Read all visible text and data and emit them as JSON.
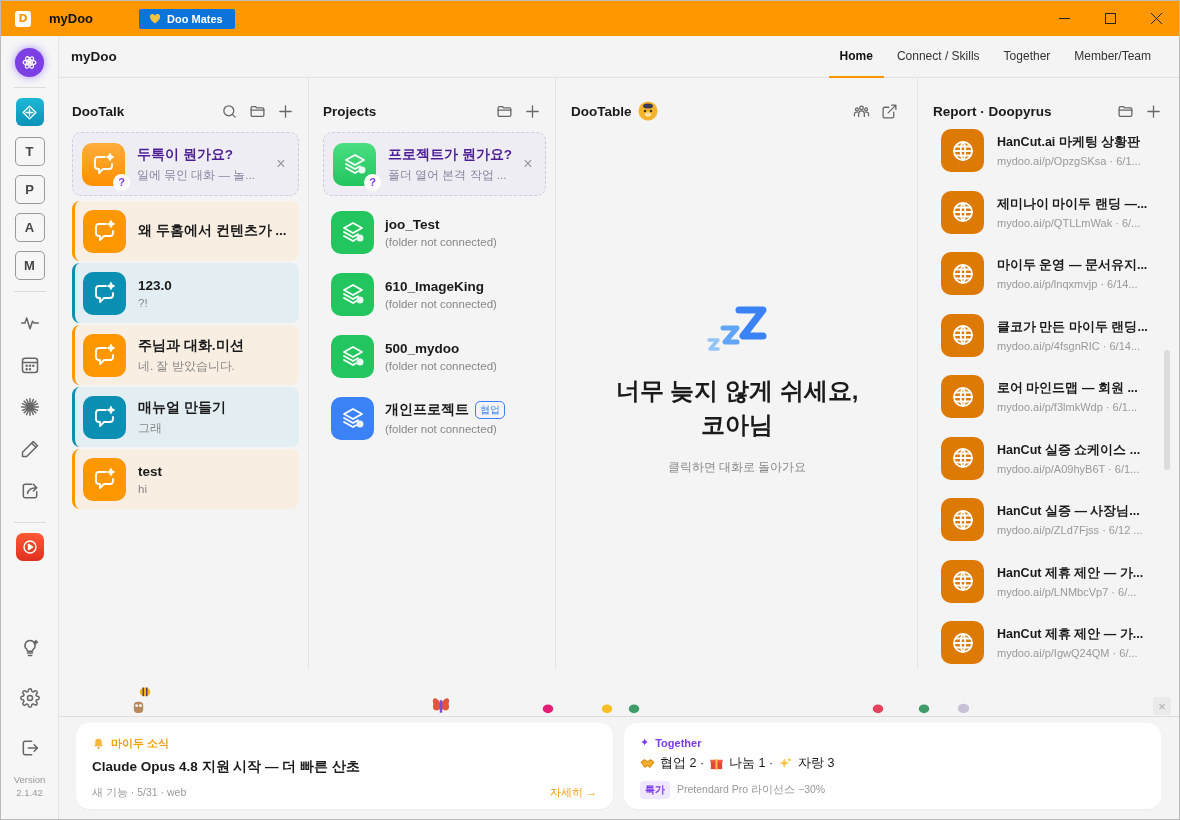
{
  "titlebar": {
    "logo": "D",
    "title": "myDoo",
    "mates_button": "Doo Mates"
  },
  "rail": {
    "letters": [
      "T",
      "P",
      "A",
      "M"
    ],
    "version_label": "Version",
    "version": "2.1.42"
  },
  "header": {
    "title": "myDoo",
    "tabs": [
      {
        "label": "Home",
        "selected": true
      },
      {
        "label": "Connect / Skills",
        "selected": false
      },
      {
        "label": "Together",
        "selected": false
      },
      {
        "label": "Member/Team",
        "selected": false
      }
    ]
  },
  "dootalk": {
    "title": "DooTalk",
    "intro": {
      "title": "두톡이 뭔가요?",
      "subtitle": "일에 묶인 대화 — 놀...",
      "badge": "?",
      "close": "×"
    },
    "chats": [
      {
        "title": "왜 두홈에서 컨텐츠가 ...",
        "color": "#ff9800"
      },
      {
        "title": "123.0",
        "subtitle": "?!",
        "color": "#0b8fb3"
      },
      {
        "title": "주님과 대화.미션",
        "subtitle": "네. 잘 받았습니다.",
        "color": "#ff9800"
      },
      {
        "title": "매뉴얼 만들기",
        "subtitle": "그래",
        "color": "#0b8fb3"
      },
      {
        "title": "test",
        "subtitle": "hi",
        "color": "#ff9800"
      }
    ]
  },
  "projects": {
    "title": "Projects",
    "intro": {
      "title": "프로젝트가 뭔가요?",
      "subtitle": "폴더 열어 본격 작업 ...",
      "badge": "?",
      "close": "×"
    },
    "items": [
      {
        "name": "joo_Test",
        "status": "(folder not connected)",
        "color": "#22c55e"
      },
      {
        "name": "610_ImageKing",
        "status": "(folder not connected)",
        "color": "#22c55e"
      },
      {
        "name": "500_mydoo",
        "status": "(folder not connected)",
        "color": "#22c55e"
      },
      {
        "name": "개인프로젝트",
        "badge": "협업",
        "status": "(folder not connected)",
        "color": "#3b82f6"
      }
    ]
  },
  "dootable": {
    "title": "DooTable",
    "message": "너무 늦지 않게 쉬세요,\n코아님",
    "hint": "클릭하면 대화로 돌아가요"
  },
  "report": {
    "title": "Report · Doopyrus",
    "items": [
      {
        "title": "HanCut.ai 마케팅 상황판",
        "link": "mydoo.ai/p/OpzgSKsa · 6/1..."
      },
      {
        "title": "제미나이 마이두 랜딩 —...",
        "link": "mydoo.ai/p/QTLLmWak · 6/..."
      },
      {
        "title": "마이두 운영 — 문서유지...",
        "link": "mydoo.ai/p/lnqxmvjp · 6/14..."
      },
      {
        "title": "클코가 만든 마이두 랜딩...",
        "link": "mydoo.ai/p/4fsgnRIC · 6/14..."
      },
      {
        "title": "로어 마인드맵 — 회원 ...",
        "link": "mydoo.ai/p/f3lmkWdp · 6/1..."
      },
      {
        "title": "HanCut 실증 쇼케이스 ...",
        "link": "mydoo.ai/p/A09hyB6T · 6/1..."
      },
      {
        "title": "HanCut 실증 — 사장님...",
        "link": "mydoo.ai/p/ZLd7Fjss · 6/12 ..."
      },
      {
        "title": "HanCut 제휴 제안 — 가...",
        "link": "mydoo.ai/p/LNMbcVp7 · 6/..."
      },
      {
        "title": "HanCut 제휴 제안 — 가...",
        "link": "mydoo.ai/p/IgwQ24QM · 6/..."
      }
    ]
  },
  "strip_close": "×",
  "news": {
    "tag": "마이두 소식",
    "headline": "Claude Opus 4.8 지원 시작 — 더 빠른 산초",
    "meta": "새 기능 · 5/31 · web",
    "link": "자세히 →"
  },
  "together": {
    "mark": "✦",
    "tag": "Together",
    "stats": [
      {
        "kind": "handshake",
        "label": "협업 2 ·"
      },
      {
        "kind": "gift",
        "label": "나눔 1 ·"
      },
      {
        "kind": "sparkles",
        "label": "자랑 3"
      }
    ],
    "badge": "특가",
    "promo": "Pretendard Pro 라이선스 −30%"
  }
}
